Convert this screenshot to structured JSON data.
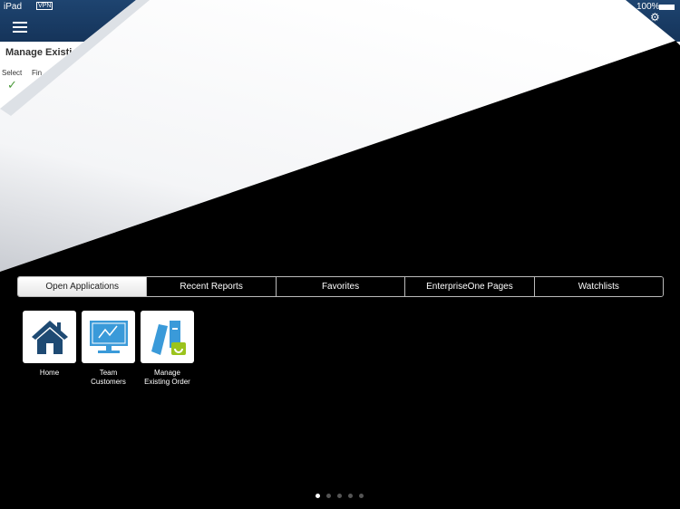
{
  "status": {
    "device": "iPad",
    "vpn": "VPN",
    "battery": "100%"
  },
  "app": {
    "title": "Manage Existi",
    "toolbar": [
      "Select",
      "Fin"
    ]
  },
  "tabs": [
    {
      "label": "Open Applications",
      "active": true
    },
    {
      "label": "Recent Reports"
    },
    {
      "label": "Favorites"
    },
    {
      "label": "EnterpriseOne Pages"
    },
    {
      "label": "Watchlists"
    }
  ],
  "apps": [
    {
      "label": "Home",
      "icon": "house-icon"
    },
    {
      "label": "Team Customers",
      "icon": "monitor-chart-icon"
    },
    {
      "label": "Manage Existing Order",
      "icon": "binders-wrench-icon"
    }
  ],
  "pager": {
    "pages": 5,
    "current": 1
  },
  "colors": {
    "header": "#1e4470",
    "icon_blue": "#3a9ad9",
    "icon_green": "#9bc31c"
  }
}
